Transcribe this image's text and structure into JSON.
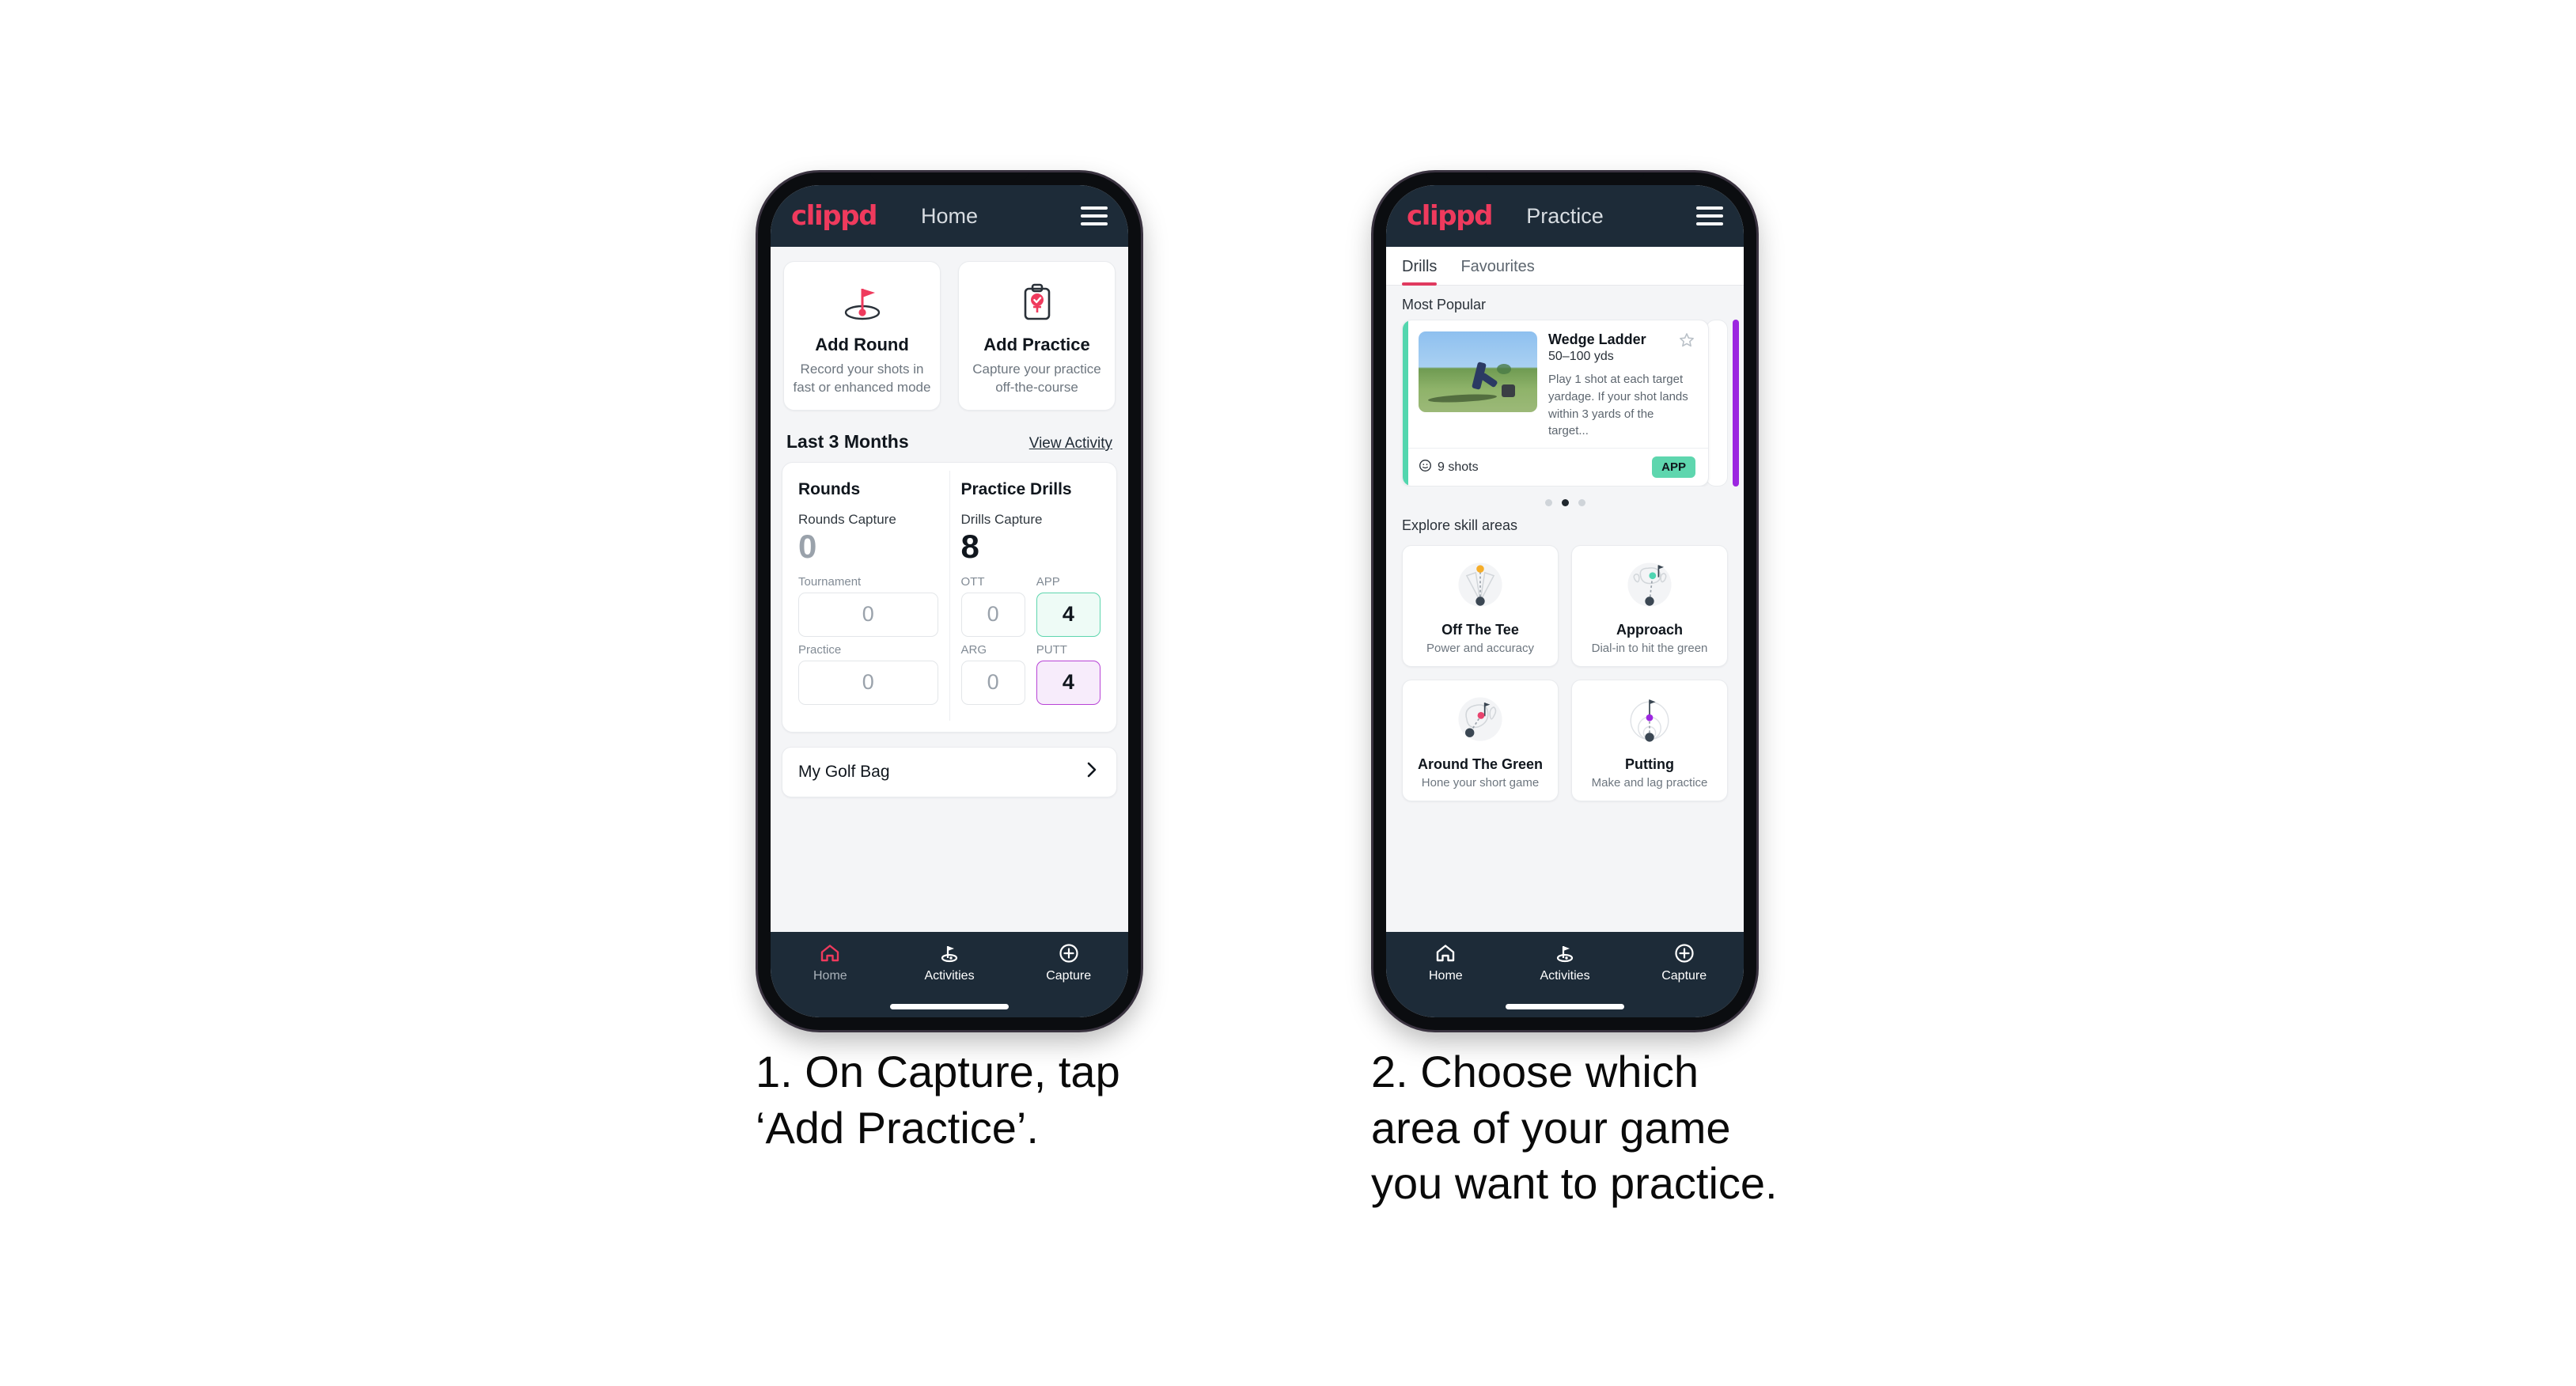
{
  "brand": {
    "logo_text": "clippd",
    "accent_pink": "#ef3a5d",
    "header_navy": "#1d2b38",
    "mint": "#5ed6ae",
    "purple": "#b843d6"
  },
  "phone1": {
    "header": {
      "title": "Home",
      "logo": "clippd",
      "menu_icon": "hamburger-menu-icon"
    },
    "actions": [
      {
        "icon": "golf-flag-hole-icon",
        "title": "Add Round",
        "subtitle": "Record your shots in fast or enhanced mode"
      },
      {
        "icon": "clipboard-check-icon",
        "title": "Add Practice",
        "subtitle": "Capture your practice off-the-course"
      }
    ],
    "section": {
      "title": "Last 3 Months",
      "link": "View Activity"
    },
    "stats": {
      "rounds": {
        "heading": "Rounds",
        "capture_label": "Rounds Capture",
        "capture_value": "0",
        "metrics": [
          {
            "label": "Tournament",
            "value": "0",
            "style": "empty"
          },
          {
            "label": "Practice",
            "value": "0",
            "style": "empty"
          }
        ]
      },
      "drills": {
        "heading": "Practice Drills",
        "capture_label": "Drills Capture",
        "capture_value": "8",
        "metrics": [
          {
            "label": "OTT",
            "value": "0",
            "style": "empty"
          },
          {
            "label": "APP",
            "value": "4",
            "style": "app"
          },
          {
            "label": "ARG",
            "value": "0",
            "style": "empty"
          },
          {
            "label": "PUTT",
            "value": "4",
            "style": "putt"
          }
        ]
      }
    },
    "golf_bag": {
      "label": "My Golf Bag",
      "chevron_icon": "chevron-right-icon"
    },
    "bottom_nav": [
      {
        "icon": "home-icon",
        "label": "Home",
        "active": true
      },
      {
        "icon": "golf-flag-icon",
        "label": "Activities",
        "active": false
      },
      {
        "icon": "plus-circle-icon",
        "label": "Capture",
        "active": false
      }
    ]
  },
  "phone2": {
    "header": {
      "title": "Practice",
      "logo": "clippd",
      "menu_icon": "hamburger-menu-icon"
    },
    "tabs": [
      {
        "label": "Drills",
        "active": true
      },
      {
        "label": "Favourites",
        "active": false
      }
    ],
    "most_popular_label": "Most Popular",
    "drill_card": {
      "thumbnail": "golfer-wedge-shot-photo",
      "name": "Wedge Ladder",
      "yardage": "50–100 yds",
      "description": "Play 1 shot at each target yardage. If your shot lands within 3 yards of the target...",
      "shots": "9 shots",
      "shots_icon": "clock-icon",
      "tag": "APP",
      "favourite_icon": "star-outline-icon",
      "accent_color": "#52d6ae"
    },
    "carousel_dots": {
      "count": 3,
      "active_index": 1
    },
    "explore_label": "Explore skill areas",
    "skill_areas": [
      {
        "icon": "off-the-tee-icon",
        "name": "Off The Tee",
        "subtitle": "Power and accuracy"
      },
      {
        "icon": "approach-icon",
        "name": "Approach",
        "subtitle": "Dial-in to hit the green"
      },
      {
        "icon": "around-the-green-icon",
        "name": "Around The Green",
        "subtitle": "Hone your short game"
      },
      {
        "icon": "putting-icon",
        "name": "Putting",
        "subtitle": "Make and lag practice"
      }
    ],
    "bottom_nav": [
      {
        "icon": "home-icon",
        "label": "Home",
        "active": false
      },
      {
        "icon": "golf-flag-icon",
        "label": "Activities",
        "active": true
      },
      {
        "icon": "plus-circle-icon",
        "label": "Capture",
        "active": false
      }
    ]
  },
  "captions": {
    "step1": "1. On Capture, tap\n‘Add Practice’.",
    "step2": "2. Choose which\narea of your game\nyou want to practice."
  }
}
